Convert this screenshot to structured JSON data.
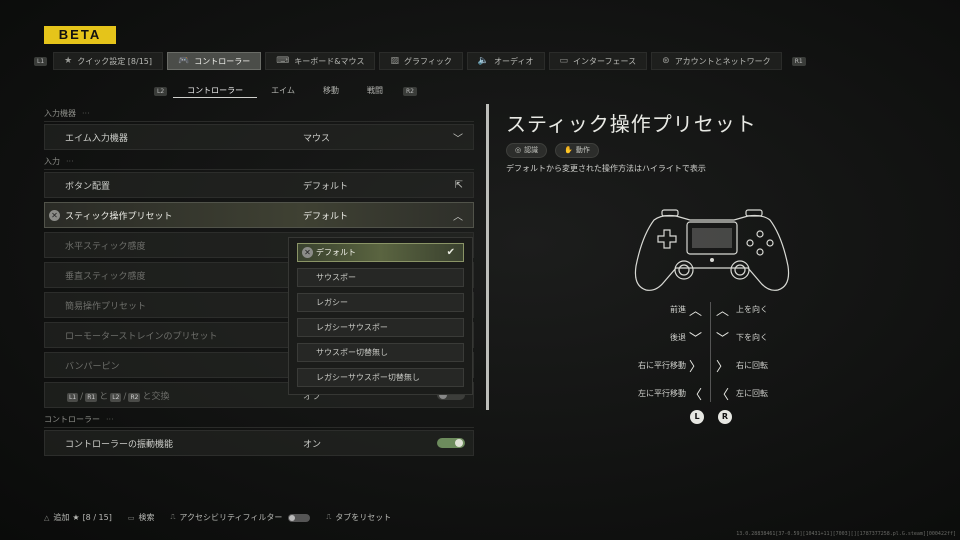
{
  "badge": "BETA",
  "topnav": {
    "left_key": "L1",
    "right_key": "R1",
    "tabs": [
      {
        "icon": "★",
        "label": "クイック設定 [8/15]",
        "active": false
      },
      {
        "icon": "🎮",
        "label": "コントローラー",
        "active": true
      },
      {
        "icon": "⌨",
        "label": "キーボード&マウス",
        "active": false
      },
      {
        "icon": "▨",
        "label": "グラフィック",
        "active": false
      },
      {
        "icon": "🔈",
        "label": "オーディオ",
        "active": false
      },
      {
        "icon": "▭",
        "label": "インターフェース",
        "active": false
      },
      {
        "icon": "⊛",
        "label": "アカウントとネットワーク",
        "active": false
      }
    ]
  },
  "subnav": {
    "left_key": "L2",
    "right_key": "R2",
    "tabs": [
      "コントローラー",
      "エイム",
      "移動",
      "戦闘"
    ]
  },
  "sections": {
    "input_device": "入力機器",
    "input": "入力",
    "controller": "コントローラー"
  },
  "rows": {
    "aim_device": {
      "label": "エイム入力機器",
      "value": "マウス"
    },
    "button_layout": {
      "label": "ボタン配置",
      "value": "デフォルト"
    },
    "stick_preset": {
      "label": "スティック操作プリセット",
      "value": "デフォルト"
    },
    "horizontal": {
      "label": "水平スティック感度"
    },
    "vertical": {
      "label": "垂直スティック感度"
    },
    "simple_preset": {
      "label": "簡易操作プリセット"
    },
    "locomotion": {
      "label": "ローモーターストレインのプリセット"
    },
    "bumper": {
      "label": "バンパーピン"
    },
    "swap": {
      "k1": "L1",
      "k2": "R1",
      "k3": "L2",
      "k4": "R2",
      "text": "と交換",
      "value": "オフ"
    },
    "vibration": {
      "label": "コントローラーの振動機能",
      "value": "オン"
    }
  },
  "dropdown": {
    "options": [
      "デフォルト",
      "サウスポー",
      "レガシー",
      "レガシーサウスポー",
      "サウスポー切替無し",
      "レガシーサウスポー切替無し"
    ],
    "selected": 0
  },
  "detail": {
    "title": "スティック操作プリセット",
    "pill_recognize": "認識",
    "pill_action": "動作",
    "description": "デフォルトから変更された操作方法はハイライトで表示"
  },
  "mapping": [
    {
      "left": "前進",
      "left_arrow": "︿",
      "right_arrow": "︿",
      "right": "上を向く"
    },
    {
      "left": "後退",
      "left_arrow": "﹀",
      "right_arrow": "﹀",
      "right": "下を向く"
    },
    {
      "left": "右に平行移動",
      "left_arrow": "〉",
      "right_arrow": "〉",
      "right": "右に回転"
    },
    {
      "left": "左に平行移動",
      "left_arrow": "〈",
      "right_arrow": "〈",
      "right": "左に回転"
    }
  ],
  "sticks": {
    "left": "L",
    "right": "R"
  },
  "bottom": {
    "add": "追加",
    "count": "[8 / 15]",
    "search": "検索",
    "accessibility": "アクセシビリティフィルター",
    "reset": "タブをリセット"
  },
  "version": "13.0.28838461[37-0.59][10431+11][7003][][1787377258.pl.G.steam][000422ff]",
  "colors": {
    "accent": "#e5c41a",
    "selected_green": "#6d8c5d"
  }
}
